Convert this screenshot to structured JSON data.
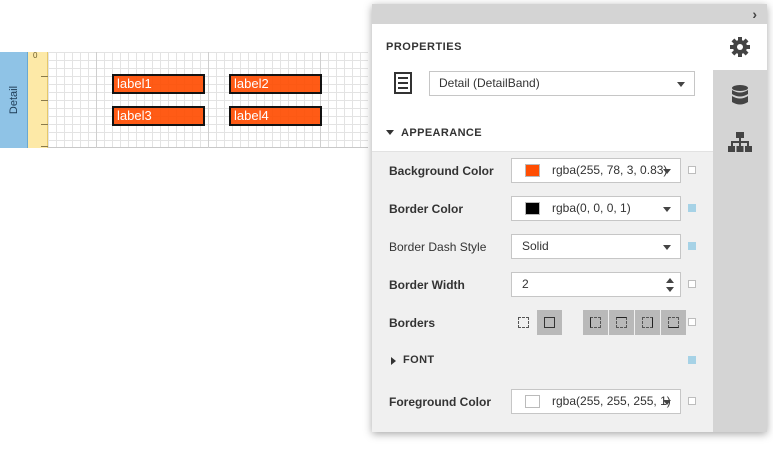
{
  "designer": {
    "band_name": "Detail",
    "ruler_zero": "0",
    "labels": [
      "label1",
      "label2",
      "label3",
      "label4"
    ],
    "label_color": "#ff4e03",
    "band_color": "#8fc3e6",
    "ruler_color": "#fde9a7"
  },
  "panel": {
    "title": "PROPERTIES",
    "band_selector": "Detail (DetailBand)",
    "tabs": [
      {
        "icon": "gear-icon",
        "active": true
      },
      {
        "icon": "database-icon",
        "active": false
      },
      {
        "icon": "hierarchy-icon",
        "active": false
      }
    ],
    "appearance_header": "APPEARANCE",
    "font_header": "FONT",
    "properties": {
      "background_color": {
        "label": "Background Color",
        "value": "rgba(255, 78, 3, 0.83)",
        "swatch": "#ff4e03"
      },
      "border_color": {
        "label": "Border Color",
        "value": "rgba(0, 0, 0, 1)",
        "swatch": "#000000"
      },
      "border_dash_style": {
        "label": "Border Dash Style",
        "value": "Solid"
      },
      "border_width": {
        "label": "Border Width",
        "value": "2"
      },
      "borders": {
        "label": "Borders"
      },
      "foreground_color": {
        "label": "Foreground Color",
        "value": "rgba(255, 255, 255, 1)",
        "swatch": "#ffffff"
      }
    }
  }
}
